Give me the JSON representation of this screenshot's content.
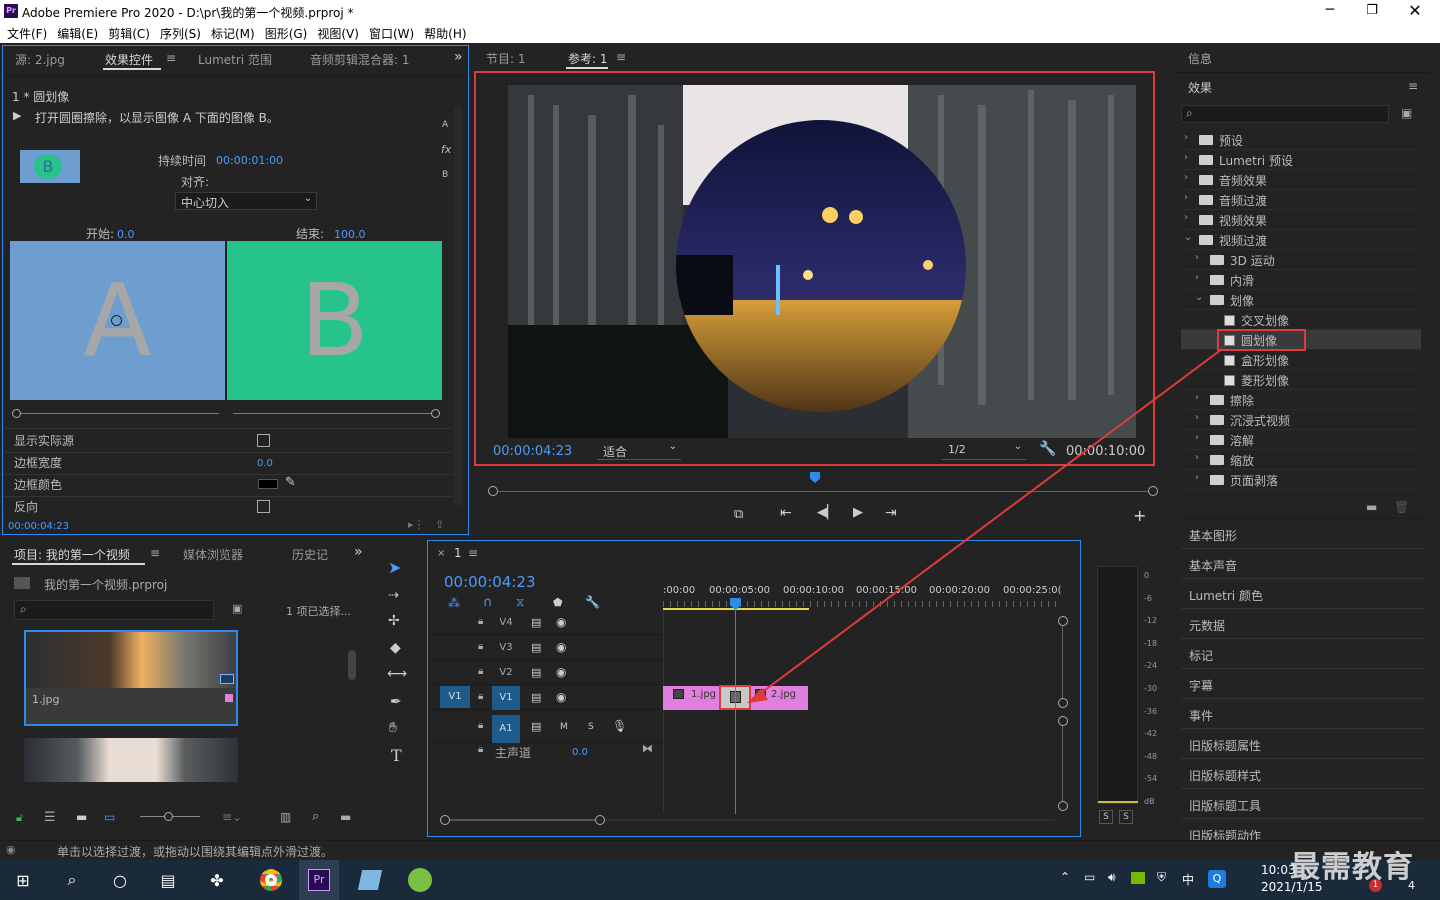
{
  "app": {
    "title": "Adobe Premiere Pro 2020 - D:\\pr\\我的第一个视频.prproj *"
  },
  "menu": [
    "文件(F)",
    "编辑(E)",
    "剪辑(C)",
    "序列(S)",
    "标记(M)",
    "图形(G)",
    "视图(V)",
    "窗口(W)",
    "帮助(H)"
  ],
  "effect_controls": {
    "tabs": [
      "源: 2.jpg",
      "效果控件",
      "Lumetri 范围",
      "音频剪辑混合器: 1"
    ],
    "clip_title": "1 * 圆划像",
    "description": "打开圆圈擦除，以显示图像 A 下面的图像 B。",
    "duration_label": "持续时间",
    "duration_value": "00:00:01:00",
    "align_label": "对齐:",
    "align_value": "中心切入",
    "start_label": "开始:",
    "start_value": "0.0",
    "end_label": "结束:",
    "end_value": "100.0",
    "thumb_a": "A",
    "thumb_b": "B",
    "badge": "B",
    "side_labels": [
      "A",
      "fx",
      "B"
    ],
    "props": [
      {
        "label": "显示实际源",
        "value": ""
      },
      {
        "label": "边框宽度",
        "value": "0.0"
      },
      {
        "label": "边框颜色",
        "value": ""
      },
      {
        "label": "反向",
        "value": ""
      }
    ],
    "timecode": "00:00:04:23"
  },
  "program": {
    "tabs": [
      "节目: 1",
      "参考: 1"
    ],
    "timecode": "00:00:04:23",
    "fit": "适合",
    "res": "1/2",
    "duration": "00:00:10:00"
  },
  "project": {
    "tabs": [
      "项目: 我的第一个视频",
      "媒体浏览器",
      "历史记"
    ],
    "file": "我的第一个视频.prproj",
    "selected": "1 项已选择...",
    "clip1": "1.jpg"
  },
  "timeline": {
    "seq": "1",
    "timecode": "00:00:04:23",
    "ruler": [
      ":00:00",
      "00:00:05:00",
      "00:00:10:00",
      "00:00:15:00",
      "00:00:20:00",
      "00:00:25:0("
    ],
    "tracks": [
      {
        "name": "V4"
      },
      {
        "name": "V3"
      },
      {
        "name": "V2"
      },
      {
        "name": "V1",
        "src": "V1"
      },
      {
        "name": "A1",
        "m": "M",
        "s": "S"
      }
    ],
    "master": "主声道",
    "master_val": "0.0",
    "clips": [
      "1.jpg",
      "2.jpg"
    ]
  },
  "meter": {
    "scale": [
      "0",
      "-6",
      "-12",
      "-18",
      "-24",
      "-30",
      "-36",
      "-42",
      "-48",
      "-54",
      "dB"
    ],
    "solo": [
      "S",
      "S"
    ]
  },
  "effects_panel": {
    "info": "信息",
    "title": "效果",
    "tree": [
      {
        "label": "预设",
        "level": 0,
        "type": "bin"
      },
      {
        "label": "Lumetri 预设",
        "level": 0,
        "type": "bin"
      },
      {
        "label": "音频效果",
        "level": 0,
        "type": "folder"
      },
      {
        "label": "音频过渡",
        "level": 0,
        "type": "folder"
      },
      {
        "label": "视频效果",
        "level": 0,
        "type": "folder"
      },
      {
        "label": "视频过渡",
        "level": 0,
        "type": "folder",
        "open": true
      },
      {
        "label": "3D 运动",
        "level": 1,
        "type": "folder"
      },
      {
        "label": "内滑",
        "level": 1,
        "type": "folder"
      },
      {
        "label": "划像",
        "level": 1,
        "type": "folder",
        "open": true
      },
      {
        "label": "交叉划像",
        "level": 2,
        "type": "fx"
      },
      {
        "label": "圆划像",
        "level": 2,
        "type": "fx",
        "selected": true
      },
      {
        "label": "盒形划像",
        "level": 2,
        "type": "fx"
      },
      {
        "label": "菱形划像",
        "level": 2,
        "type": "fx"
      },
      {
        "label": "擦除",
        "level": 1,
        "type": "folder"
      },
      {
        "label": "沉浸式视频",
        "level": 1,
        "type": "folder"
      },
      {
        "label": "溶解",
        "level": 1,
        "type": "folder"
      },
      {
        "label": "缩放",
        "level": 1,
        "type": "folder"
      },
      {
        "label": "页面剥落",
        "level": 1,
        "type": "folder"
      }
    ],
    "panels": [
      "基本图形",
      "基本声音",
      "Lumetri 颜色",
      "元数据",
      "标记",
      "字幕",
      "事件",
      "旧版标题属性",
      "旧版标题样式",
      "旧版标题工具",
      "旧版标题动作"
    ]
  },
  "status": "单击以选择过渡，或拖动以围绕其编辑点外滑过渡。",
  "taskbar": {
    "time": "10:03",
    "date": "2021/1/15",
    "ime": "中",
    "watermark": "最需教育",
    "badge1": "1",
    "badge2": "4"
  },
  "colors": {
    "accent": "#2d8ceb",
    "clip": "#e07fe0",
    "highlight": "#e03a3a",
    "a_thumb": "#6e9ed0",
    "b_thumb": "#26c48a"
  }
}
